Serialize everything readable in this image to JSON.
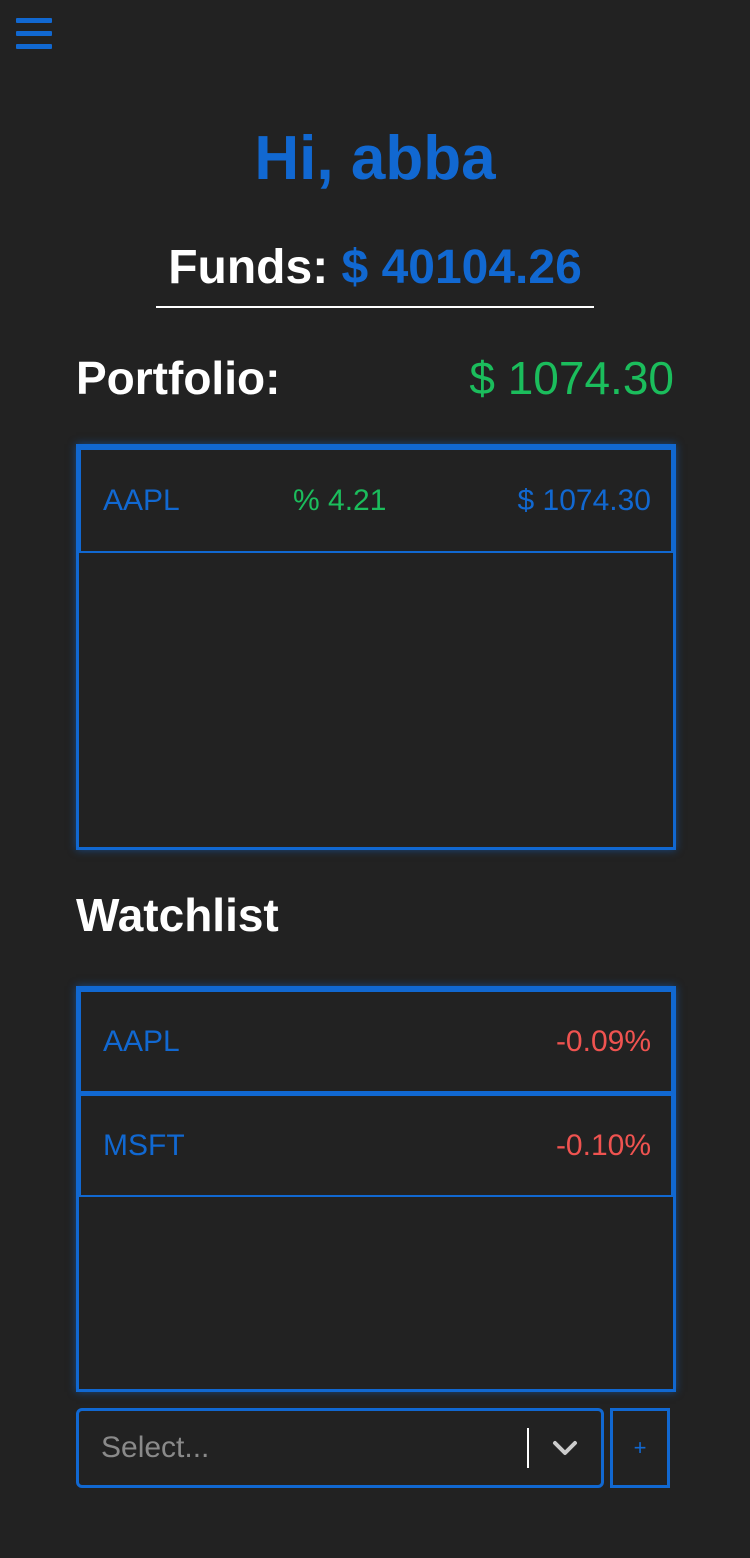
{
  "header": {
    "menu_icon": "hamburger-menu-icon",
    "greeting": "Hi, abba"
  },
  "funds": {
    "label": "Funds:",
    "value": "$ 40104.26"
  },
  "portfolio": {
    "title": "Portfolio:",
    "total": "$ 1074.30",
    "rows": [
      {
        "symbol": "AAPL",
        "percent": "% 4.21",
        "value": "$ 1074.30"
      }
    ]
  },
  "watchlist": {
    "title": "Watchlist",
    "rows": [
      {
        "symbol": "AAPL",
        "change": "-0.09%"
      },
      {
        "symbol": "MSFT",
        "change": "-0.10%"
      }
    ]
  },
  "add_control": {
    "placeholder": "Select...",
    "dropdown_icon": "chevron-down-icon",
    "add_label": "+"
  },
  "colors": {
    "background": "#222222",
    "accent": "#1168d1",
    "positive": "#1bbd5c",
    "negative": "#ef5350",
    "text": "#ffffff"
  }
}
